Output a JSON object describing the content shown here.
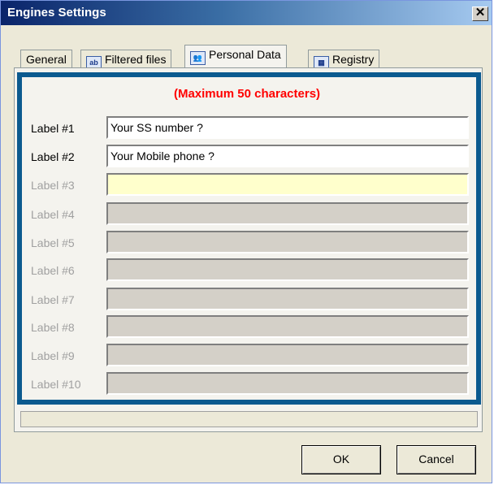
{
  "window": {
    "title": "Engines Settings",
    "close_glyph": "✕"
  },
  "tabs": [
    {
      "label": "General",
      "icon": "",
      "active": false
    },
    {
      "label": "Filtered files",
      "icon": "ab",
      "active": false
    },
    {
      "label": "Personal Data",
      "icon": "person-card",
      "active": true
    },
    {
      "label": "Registry",
      "icon": "registry-grid",
      "active": false
    }
  ],
  "note": "(Maximum 50 characters)",
  "rows": [
    {
      "label": "Label #1",
      "value": "Your SS number ?",
      "state": "enabled"
    },
    {
      "label": "Label #2",
      "value": "Your Mobile phone ?",
      "state": "enabled"
    },
    {
      "label": "Label #3",
      "value": "",
      "state": "focused"
    },
    {
      "label": "Label #4",
      "value": "",
      "state": "disabled"
    },
    {
      "label": "Label #5",
      "value": "",
      "state": "disabled"
    },
    {
      "label": "Label #6",
      "value": "",
      "state": "disabled"
    },
    {
      "label": "Label #7",
      "value": "",
      "state": "disabled"
    },
    {
      "label": "Label #8",
      "value": "",
      "state": "disabled"
    },
    {
      "label": "Label #9",
      "value": "",
      "state": "disabled"
    },
    {
      "label": "Label #10",
      "value": "",
      "state": "disabled"
    }
  ],
  "buttons": {
    "ok_label": "OK",
    "cancel_label": "Cancel"
  },
  "colors": {
    "highlight": "#0b5a8f",
    "note": "#ff0000",
    "focused_field": "#ffffcc",
    "disabled_field": "#d4d0c8"
  }
}
